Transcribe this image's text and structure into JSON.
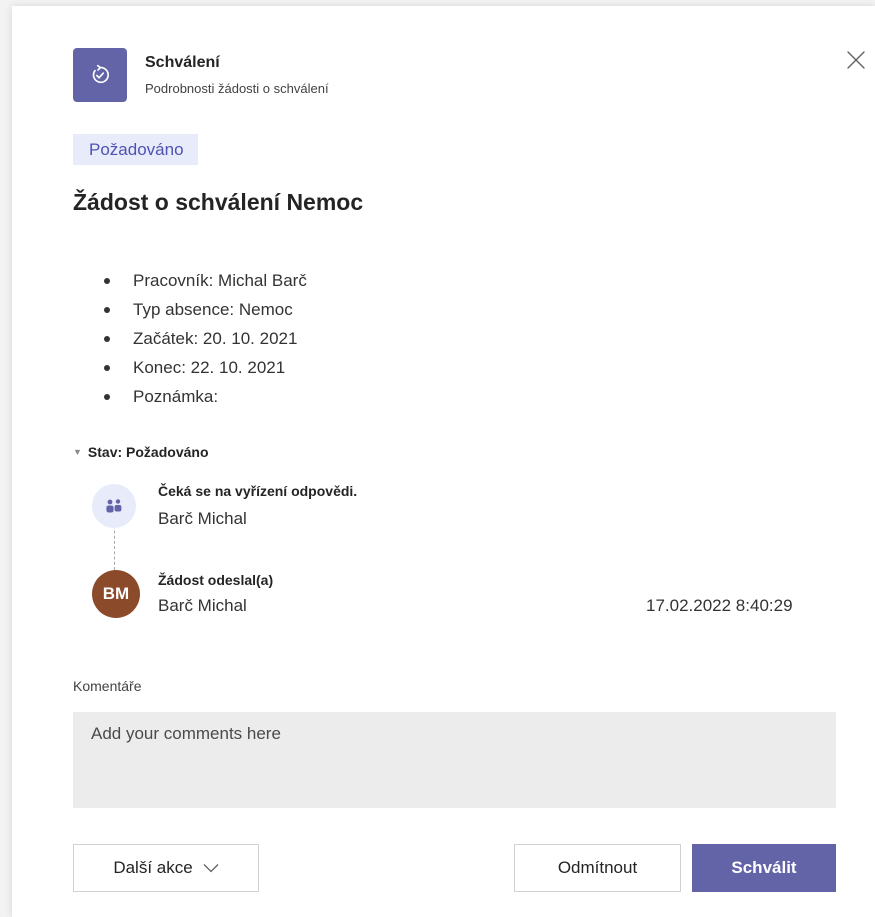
{
  "header": {
    "app_name": "Schválení",
    "subtitle": "Podrobnosti žádosti o schválení",
    "app_icon": "approvals-icon",
    "close_icon": "close-icon"
  },
  "status_badge": "Požadováno",
  "request_title": "Žádost o schválení Nemoc",
  "details": [
    "Pracovník: Michal Barč",
    "Typ absence: Nemoc",
    "Začátek: 20. 10. 2021",
    "Konec: 22. 10. 2021",
    "Poznámka:"
  ],
  "status_section": {
    "label": "Stav: Požadováno",
    "timeline": [
      {
        "label": "Čeká se na vyřízení odpovědi.",
        "name": "Barč Michal",
        "icon": "people-icon"
      },
      {
        "label": "Žádost odeslal(a)",
        "name": "Barč Michal",
        "avatar_initials": "BM",
        "timestamp": "17.02.2022 8:40:29"
      }
    ]
  },
  "comments": {
    "label": "Komentáře",
    "placeholder": "Add your comments here"
  },
  "actions": {
    "more_label": "Další akce",
    "reject_label": "Odmítnout",
    "approve_label": "Schválit"
  },
  "colors": {
    "accent": "#6264a7",
    "badge_bg": "#e8ebfa",
    "avatar_bg": "#8b4a29"
  }
}
